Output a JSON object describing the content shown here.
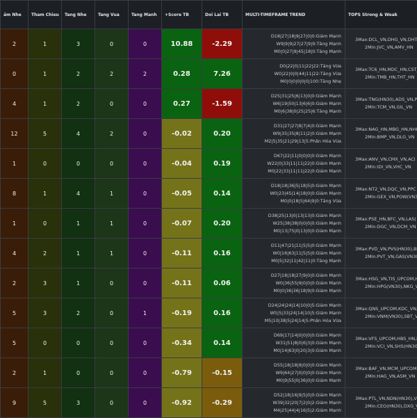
{
  "headers": [
    "ảm Nhe",
    "Tham Chieu",
    "Tang Nhe",
    "Tang Vua",
    "Tang Manh",
    "+Score TB",
    "Doi Lai TB",
    "MULTI-TIMEFRAME TREND",
    "TOPS Strong & Weak"
  ],
  "rows": [
    {
      "giam": "2",
      "tham": "1",
      "tnhe": "3",
      "tvua": "0",
      "tmanh": "0",
      "score": "10.88",
      "doi": "-2.29",
      "trend": [
        "D18|27|18|9|27|0|0:Giảm Mạnh",
        "W9|9|9|27|27|9|9:Tăng Mạnh",
        "M0|0|27|9|45|18|0:Tăng Mạnh"
      ],
      "tops": [
        "3Max:DCL_VN,DHG_VN,DHT(",
        "2Min:JVC_VN,AMV_HN"
      ]
    },
    {
      "giam": "0",
      "tham": "1",
      "tnhe": "2",
      "tvua": "2",
      "tmanh": "2",
      "score": "0.28",
      "doi": "7.26",
      "trend": [
        "D0|22|0|11|22|22:Tăng Vừa",
        "W0|22|0|0|44|11|22:Tăng Vừa",
        "M0|0|0|0|0|0|100:Tăng Nhẹ"
      ],
      "tops": [
        "3Max:TC6_HN,MDC_HN,CST_L",
        "2Min:TMB_HN,THT_HN"
      ]
    },
    {
      "giam": "4",
      "tham": "1",
      "tnhe": "2",
      "tvua": "0",
      "tmanh": "0",
      "score": "0.27",
      "doi": "-1.59",
      "trend": [
        "D25|31|25|6|13|0|0:Giảm Mạnh",
        "W6|19|50|13|6|6|0:Giảm Mạnh",
        "M0|6|38|0|25|25|6:Tăng Mạnh"
      ],
      "tops": [
        "3Max:TNG(HN30),ADS_VN,PPH",
        "2Min:TCM_VN,GIL_VN"
      ]
    },
    {
      "giam": "12",
      "tham": "5",
      "tnhe": "4",
      "tvua": "2",
      "tmanh": "0",
      "score": "-0.02",
      "doi": "0.20",
      "trend": [
        "D31|27|27|8|7|4|0:Giảm Mạnh",
        "W9|35|35|8|11|2|0:Giảm Mạnh",
        "M2|5|35|21|29|13|5:Phân Hóa Vừa"
      ],
      "tops": [
        "3Max:NAG_HN,MBG_HN,NHH_(",
        "2Min:BMP_VN,DLG_VN"
      ]
    },
    {
      "giam": "1",
      "tham": "0",
      "tnhe": "0",
      "tvua": "0",
      "tmanh": "0",
      "score": "-0.04",
      "doi": "0.19",
      "trend": [
        "D67|22|11|0|0|0|0:Giảm Mạnh",
        "W22|0|33|11|11|22|0:Giảm Mạnh",
        "M0|22|33|11|11|22|0:Giảm Mạnh"
      ],
      "tops": [
        "3Max:ANV_VN,CMX_VN,ACI",
        "2Min:IDI_VN,VHC_VN"
      ]
    },
    {
      "giam": "8",
      "tham": "1",
      "tnhe": "4",
      "tvua": "1",
      "tmanh": "0",
      "score": "-0.05",
      "doi": "0.14",
      "trend": [
        "D18|18|36|5|18|5|0:Giảm Mạnh",
        "W0|23|45|14|18|0|0:Giảm Mạnh",
        "M0|0|18|5|64|9|0:Tăng Vừa"
      ],
      "tops": [
        "3Max:NT2_VN,DQC_VN,PPC",
        "2Min:GEX_VN,POW(VN30)"
      ]
    },
    {
      "giam": "1",
      "tham": "0",
      "tnhe": "1",
      "tvua": "1",
      "tmanh": "0",
      "score": "-0.07",
      "doi": "0.20",
      "trend": [
        "D38|25|13|0|13|13|0:Giảm Mạnh",
        "W25|38|38|0|0|0|0:Giảm Mạnh",
        "M0|13|75|0|13|0|0:Giảm Mạnh"
      ],
      "tops": [
        "3Max:PSE_HN,BFC_VN,LAS(",
        "2Min:DGC_VN,DCM_VN"
      ]
    },
    {
      "giam": "4",
      "tham": "2",
      "tnhe": "1",
      "tvua": "1",
      "tmanh": "0",
      "score": "-0.11",
      "doi": "0.16",
      "trend": [
        "D11|47|21|11|5|5|0:Giảm Mạnh",
        "W0|16|63|11|5|5|0:Giảm Mạnh",
        "M0|5|32|11|42|11|0:Tăng Mạnh"
      ],
      "tops": [
        "3Max:PVD_VN,PVS(HN30),BSR",
        "2Min:PVT_VN,GAS(VN30)"
      ]
    },
    {
      "giam": "2",
      "tham": "3",
      "tnhe": "1",
      "tvua": "0",
      "tmanh": "0",
      "score": "-0.11",
      "doi": "0.06",
      "trend": [
        "D27|18|18|27|9|0|0:Giảm Mạnh",
        "W0|36|55|9|0|0|0:Giảm Mạnh",
        "M0|0|36|36|18|9|0:Giảm Mạnh"
      ],
      "tops": [
        "3Max:HSG_VN,TIS_UPCOM,HM",
        "2Min:HPG(VN30),NKG_V"
      ]
    },
    {
      "giam": "5",
      "tham": "3",
      "tnhe": "2",
      "tvua": "0",
      "tmanh": "1",
      "score": "-0.19",
      "doi": "0.16",
      "trend": [
        "D24|24|24|14|10|0|5:Giảm Mạnh",
        "W5|5|33|24|14|10|5:Giảm Mạnh",
        "M5|10|38|5|24|14|5:Phân Hóa Vừa"
      ],
      "tops": [
        "3Max:QNS_UPCOM,KDC_VN,SLS",
        "2Min:VNM(VN30),SBT_VN"
      ]
    },
    {
      "giam": "5",
      "tham": "0",
      "tnhe": "0",
      "tvua": "0",
      "tmanh": "0",
      "score": "-0.34",
      "doi": "0.14",
      "trend": [
        "D69|17|14|0|0|0|0:Giảm Mạnh",
        "W31|51|8|0|6|3|0:Giảm Mạnh",
        "M0|14|63|0|20|3|0:Giảm Mạnh"
      ],
      "tops": [
        "3Max:VFS_UPCOM,HBS_HN,P",
        "2Min:VCI_VN,SHS(HN30)"
      ]
    },
    {
      "giam": "2",
      "tham": "1",
      "tnhe": "0",
      "tvua": "0",
      "tmanh": "0",
      "score": "-0.79",
      "doi": "-0.15",
      "trend": [
        "D55|18|18|9|0|0|0:Giảm Mạnh",
        "W9|64|27|0|0|0|0:Giảm Mạnh",
        "M0|9|55|0|36|0|0:Giảm Mạnh"
      ],
      "tops": [
        "3Max:BAF_VN,MCM_UPCOM,F",
        "2Min:HAG_VN,ASM_VN"
      ]
    },
    {
      "giam": "9",
      "tham": "5",
      "tnhe": "3",
      "tvua": "0",
      "tmanh": "0",
      "score": "-0.92",
      "doi": "-0.29",
      "trend": [
        "D52|18|16|9|5|0|0:Giảm Mạnh",
        "W39|32|20|7|2|0|2:Giảm Mạnh",
        "M4|25|44|4|16|5|2:Giảm Mạnh"
      ],
      "tops": [
        "3Max:PTL_VN,NDN(HN30),VH",
        "2Min:CEO(HN30),DXG_V"
      ]
    }
  ]
}
